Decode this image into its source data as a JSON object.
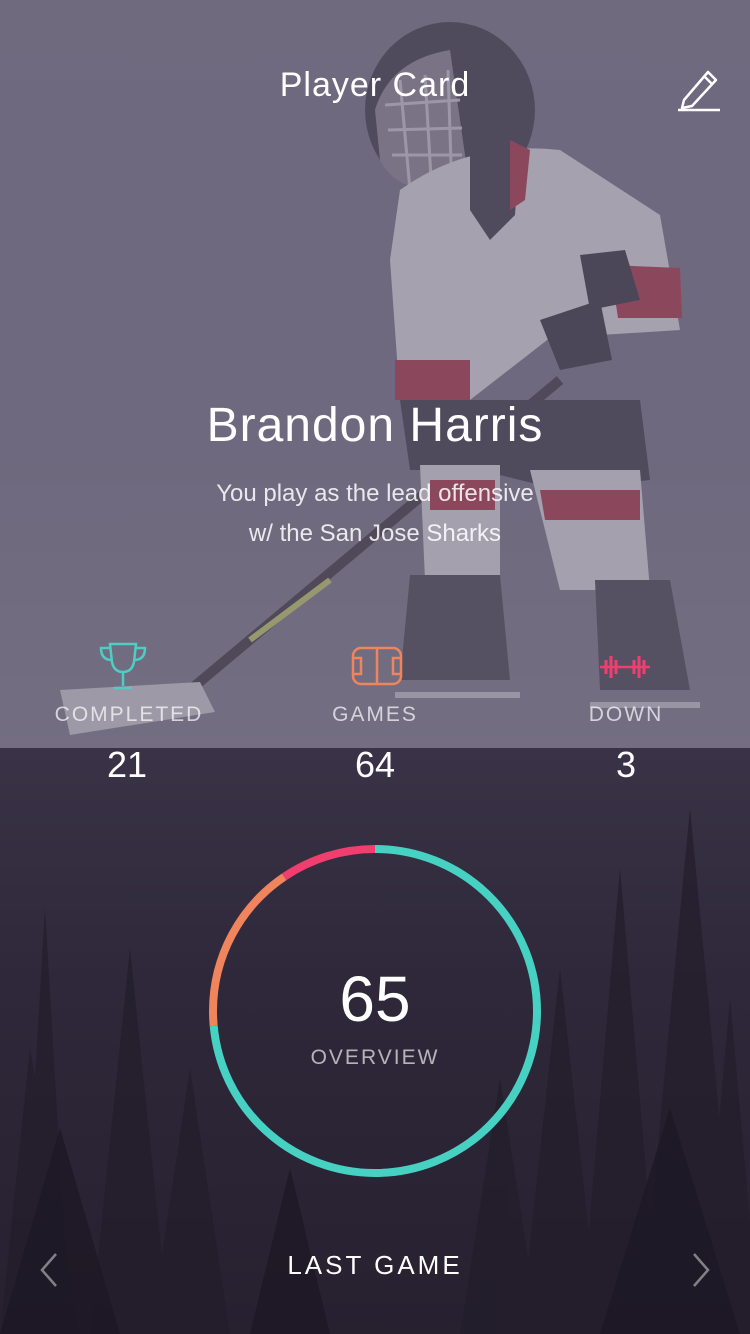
{
  "header": {
    "title": "Player Card",
    "edit_icon": "pencil-icon"
  },
  "player": {
    "name": "Brandon Harris",
    "description_line1": "You play as the lead offensive",
    "description_line2": "w/ the San Jose Sharks"
  },
  "stats": [
    {
      "label": "COMPLETED",
      "value": "21",
      "icon": "trophy-icon",
      "color": "#4ecdc4"
    },
    {
      "label": "GAMES",
      "value": "64",
      "icon": "rink-icon",
      "color": "#f0845c"
    },
    {
      "label": "DOWN",
      "value": "3",
      "icon": "dumbbell-icon",
      "color": "#f03e6e"
    }
  ],
  "overview": {
    "value": "65",
    "label": "OVERVIEW",
    "segments": [
      {
        "name": "teal",
        "color": "#46d1c2",
        "fraction": 0.735
      },
      {
        "name": "orange",
        "color": "#f0845c",
        "fraction": 0.17
      },
      {
        "name": "red",
        "color": "#f03e6e",
        "fraction": 0.095
      }
    ]
  },
  "footer": {
    "label": "LAST GAME",
    "prev_icon": "chevron-left-icon",
    "next_icon": "chevron-right-icon"
  }
}
